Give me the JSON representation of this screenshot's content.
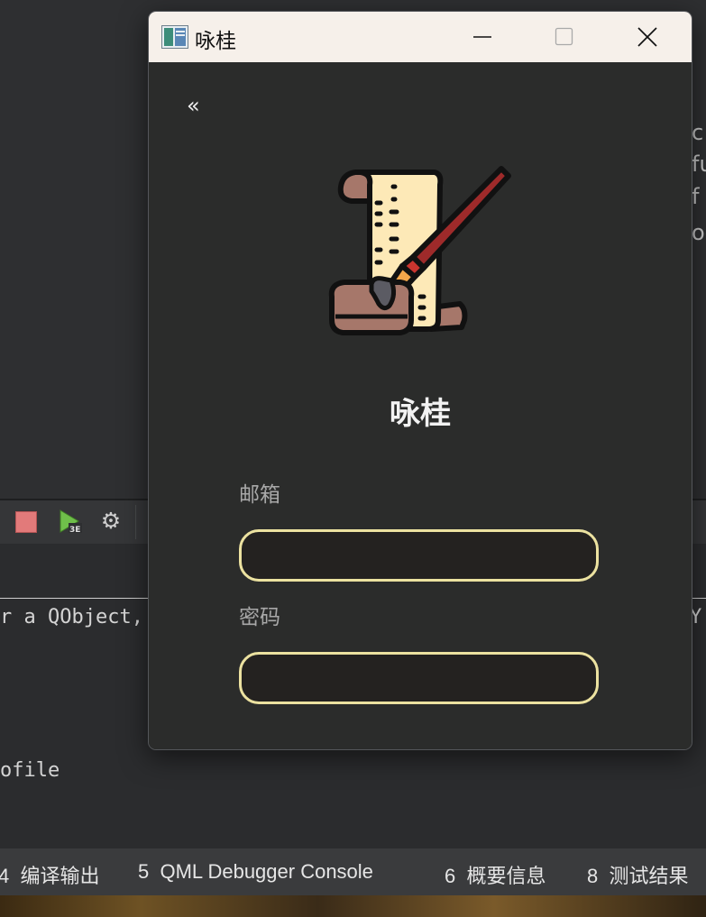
{
  "background": {
    "side_lines": [
      "c",
      "fu",
      "f",
      "og"
    ],
    "output_lines": [
      "r a QObject,",
      "Y",
      "ofile"
    ],
    "bottom_tabs": [
      {
        "num": "4",
        "label": "编译输出"
      },
      {
        "num": "5",
        "label": "QML Debugger Console"
      },
      {
        "num": "6",
        "label": "概要信息"
      },
      {
        "num": "8",
        "label": "测试结果"
      }
    ]
  },
  "window": {
    "title": "咏桂",
    "back_label": "«",
    "app_name": "咏桂",
    "email_label": "邮箱",
    "email_value": "",
    "password_label": "密码",
    "password_value": ""
  },
  "colors": {
    "field_border": "#ece2a0",
    "field_bg": "#242220",
    "window_bg": "#2b2c2b",
    "titlebar_bg": "#f6f0ea"
  }
}
